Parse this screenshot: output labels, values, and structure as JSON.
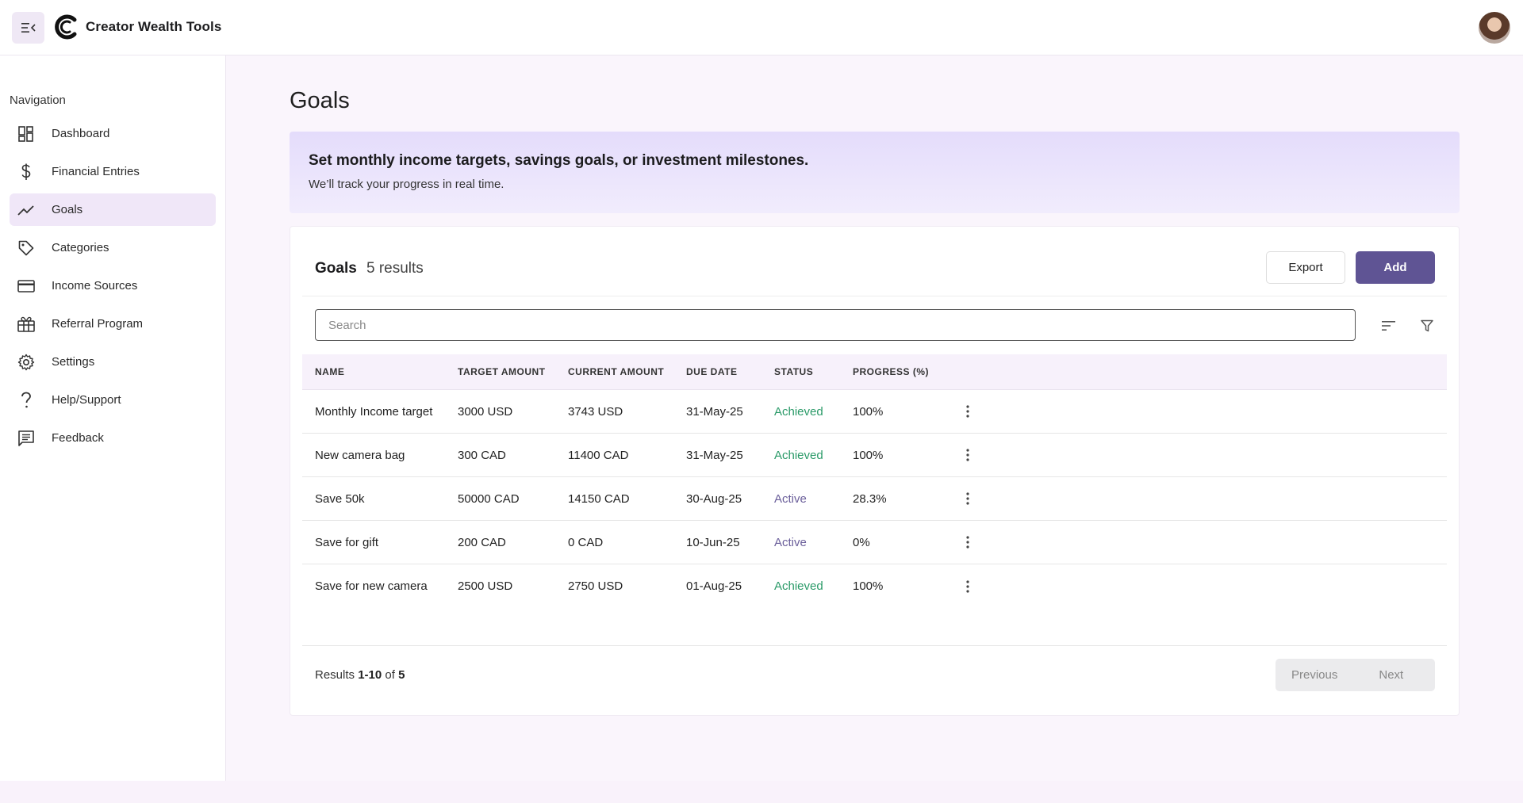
{
  "app": {
    "title": "Creator Wealth Tools"
  },
  "sidebar": {
    "heading": "Navigation",
    "items": [
      {
        "label": "Dashboard",
        "icon": "dashboard-icon",
        "active": false
      },
      {
        "label": "Financial Entries",
        "icon": "dollar-icon",
        "active": false
      },
      {
        "label": "Goals",
        "icon": "trending-up-icon",
        "active": true
      },
      {
        "label": "Categories",
        "icon": "tag-icon",
        "active": false
      },
      {
        "label": "Income Sources",
        "icon": "credit-card-icon",
        "active": false
      },
      {
        "label": "Referral Program",
        "icon": "gift-icon",
        "active": false
      },
      {
        "label": "Settings",
        "icon": "gear-icon",
        "active": false
      },
      {
        "label": "Help/Support",
        "icon": "question-icon",
        "active": false
      },
      {
        "label": "Feedback",
        "icon": "feedback-icon",
        "active": false
      }
    ]
  },
  "page": {
    "title": "Goals"
  },
  "banner": {
    "title": "Set monthly income targets, savings goals, or investment milestones.",
    "subtitle": "We’ll track your progress in real time."
  },
  "card": {
    "title": "Goals",
    "count": "5 results",
    "export_label": "Export",
    "add_label": "Add",
    "search_placeholder": "Search"
  },
  "table": {
    "columns": [
      "NAME",
      "TARGET AMOUNT",
      "CURRENT AMOUNT",
      "DUE DATE",
      "STATUS",
      "PROGRESS (%)"
    ],
    "rows": [
      {
        "name": "Monthly Income target",
        "target": "3000 USD",
        "current": "3743 USD",
        "due": "31-May-25",
        "status": "Achieved",
        "progress": "100%"
      },
      {
        "name": "New camera bag",
        "target": "300 CAD",
        "current": "11400 CAD",
        "due": "31-May-25",
        "status": "Achieved",
        "progress": "100%"
      },
      {
        "name": "Save 50k",
        "target": "50000 CAD",
        "current": "14150 CAD",
        "due": "30-Aug-25",
        "status": "Active",
        "progress": "28.3%"
      },
      {
        "name": "Save for gift",
        "target": "200 CAD",
        "current": "0 CAD",
        "due": "10-Jun-25",
        "status": "Active",
        "progress": "0%"
      },
      {
        "name": "Save for new camera",
        "target": "2500 USD",
        "current": "2750 USD",
        "due": "01-Aug-25",
        "status": "Achieved",
        "progress": "100%"
      }
    ]
  },
  "footer": {
    "results_prefix": "Results",
    "results_range": "1-10",
    "results_of": "of",
    "results_total": "5",
    "previous_label": "Previous",
    "next_label": "Next"
  },
  "colors": {
    "accent": "#5f5494",
    "achieved": "#2a9a68",
    "active": "#6a5e9a",
    "nav_active_bg": "#f0e7f8",
    "banner_bg": "#e4dcfb"
  }
}
